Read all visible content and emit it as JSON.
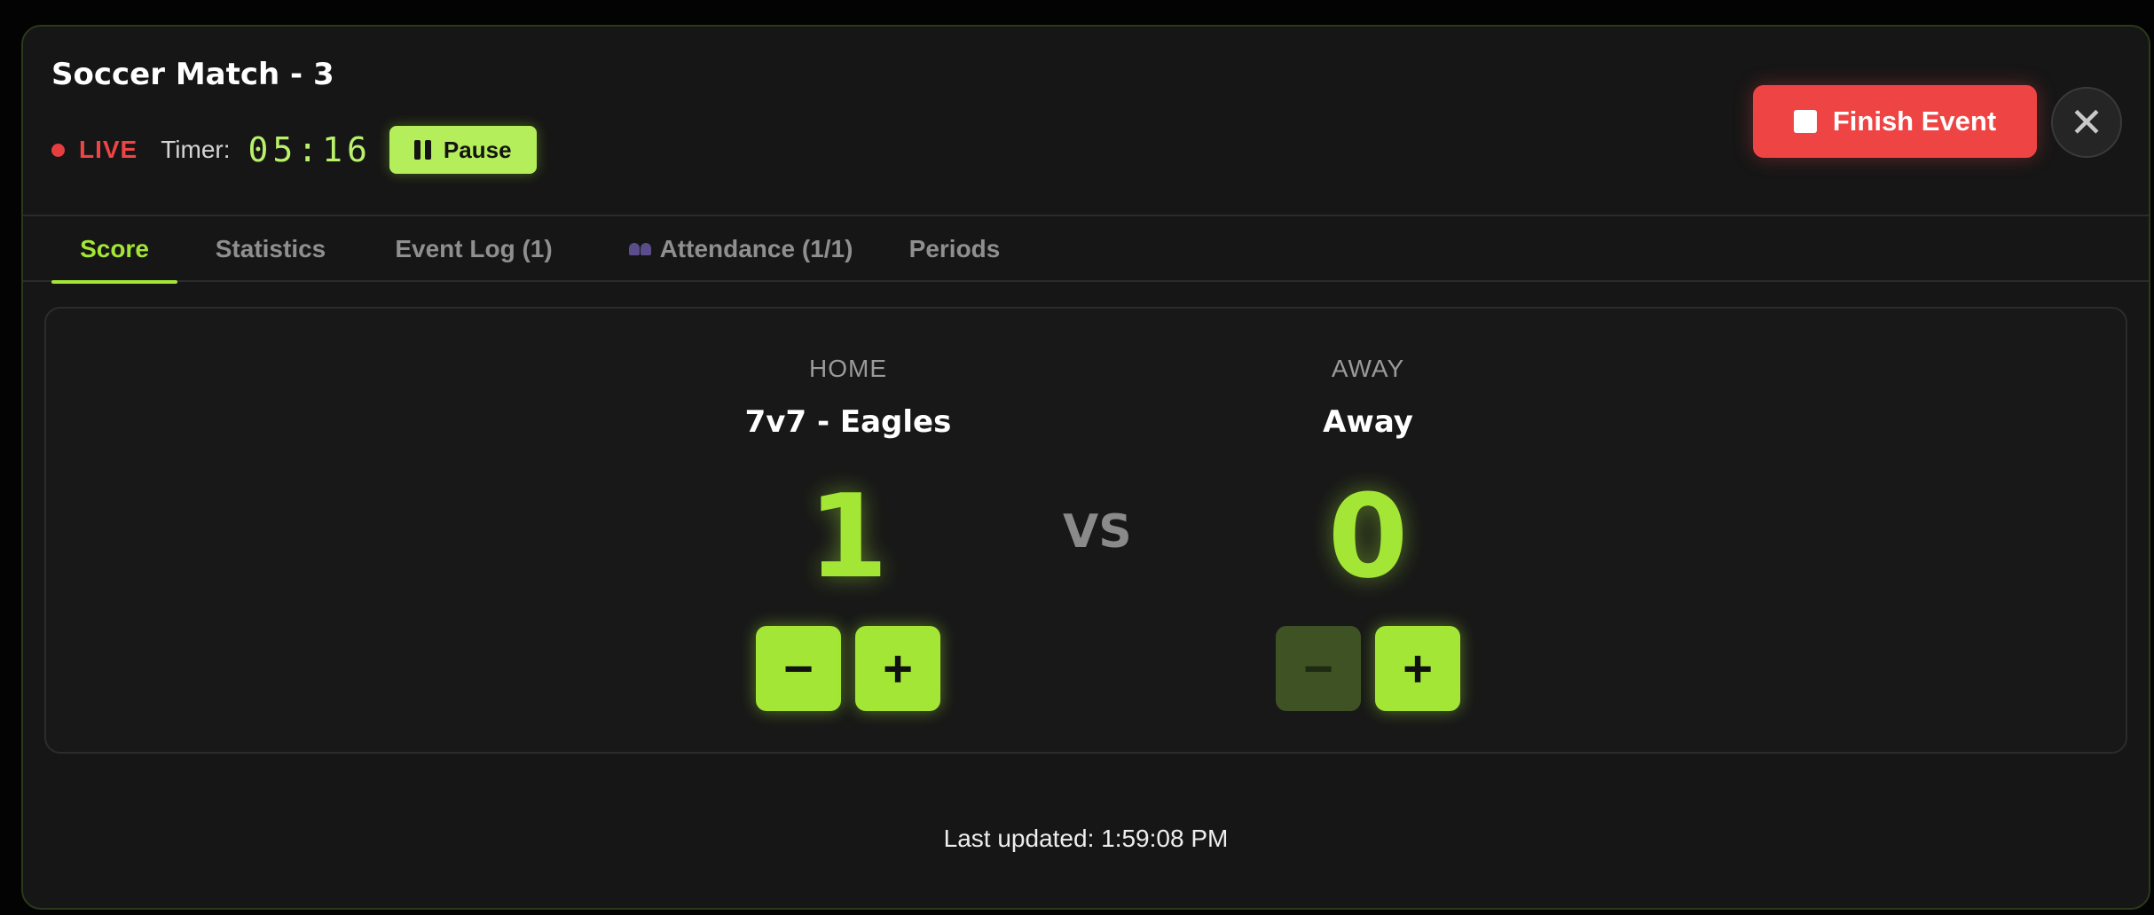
{
  "header": {
    "title": "Soccer Match - 3",
    "live_label": "LIVE",
    "timer_label": "Timer:",
    "timer_value": "05:16",
    "pause_label": "Pause",
    "finish_label": "Finish Event",
    "close_symbol": "✕"
  },
  "tabs": [
    {
      "label": "Score",
      "active": true
    },
    {
      "label": "Statistics",
      "active": false
    },
    {
      "label": "Event Log (1)",
      "active": false
    },
    {
      "label": "Attendance (1/1)",
      "active": false,
      "icon": "people-icon"
    },
    {
      "label": "Periods",
      "active": false
    }
  ],
  "score": {
    "home": {
      "role": "HOME",
      "name": "7v7 - Eagles",
      "score": "1"
    },
    "away": {
      "role": "AWAY",
      "name": "Away",
      "score": "0"
    },
    "vs_label": "VS",
    "decrement_symbol": "−",
    "increment_symbol": "+"
  },
  "footer": {
    "last_updated": "Last updated: 1:59:08 PM"
  },
  "colors": {
    "accent": "#a3e635",
    "live": "#ef4444",
    "finish_button": "#ef4444",
    "background": "#161616"
  }
}
